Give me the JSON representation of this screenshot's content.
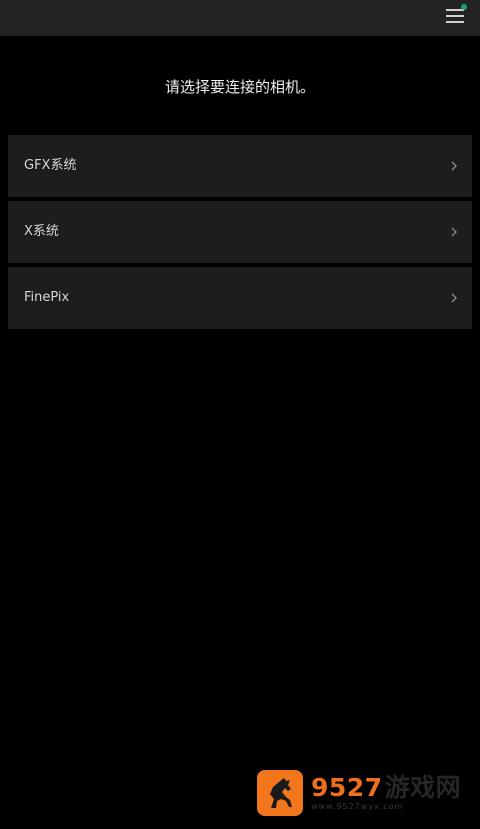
{
  "header": {
    "menu_icon": "hamburger-menu-icon",
    "notification_color": "#1fa364"
  },
  "prompt_text": "请选择要连接的相机。",
  "camera_series": [
    {
      "label": "GFX系统",
      "icon": "chevron-right-icon"
    },
    {
      "label": "X系统",
      "icon": "chevron-right-icon"
    },
    {
      "label": "FinePix",
      "icon": "chevron-right-icon"
    }
  ],
  "watermark": {
    "number": "9527",
    "site_name": "游戏网",
    "url": "www.9527wyx.com",
    "brand_color": "#f2761c"
  }
}
